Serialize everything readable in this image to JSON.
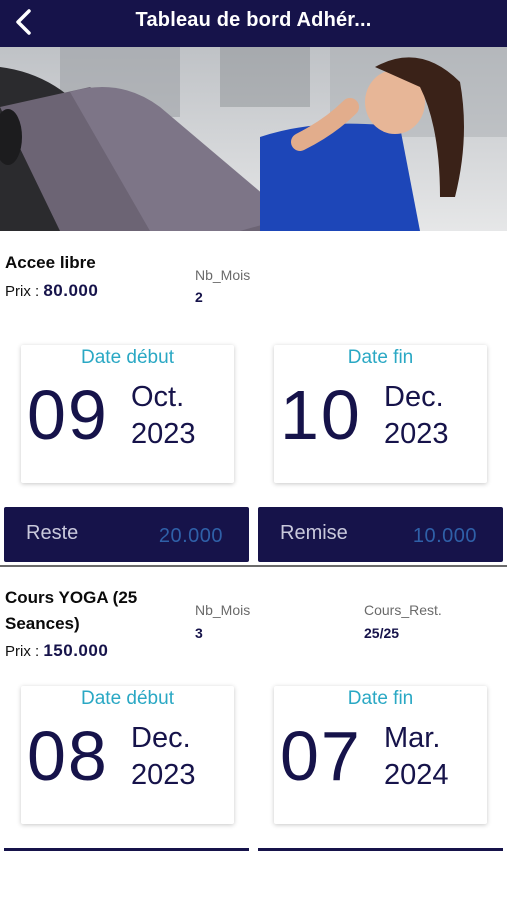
{
  "header": {
    "title": "Tableau de bord Adhér..."
  },
  "subscriptions": [
    {
      "name_line1": "Accee libre",
      "name_line2": "",
      "prix_label": "Prix :",
      "prix_value": "80.000",
      "nb_mois_label": "Nb_Mois",
      "nb_mois_value": "2",
      "date_debut": {
        "label": "Date début",
        "day": "09",
        "month": "Oct.",
        "year": "2023"
      },
      "date_fin": {
        "label": "Date fin",
        "day": "10",
        "month": "Dec.",
        "year": "2023"
      },
      "reste_label": "Reste",
      "reste_value": "20.000",
      "remise_label": "Remise",
      "remise_value": "10.000"
    },
    {
      "name_line1": "Cours YOGA (25",
      "name_line2": "Seances)",
      "prix_label": "Prix :",
      "prix_value": "150.000",
      "nb_mois_label": "Nb_Mois",
      "nb_mois_value": "3",
      "cours_rest_label": "Cours_Rest.",
      "cours_rest_value": "25/25",
      "date_debut": {
        "label": "Date début",
        "day": "08",
        "month": "Dec.",
        "year": "2023"
      },
      "date_fin": {
        "label": "Date fin",
        "day": "07",
        "month": "Mar.",
        "year": "2024"
      }
    }
  ]
}
